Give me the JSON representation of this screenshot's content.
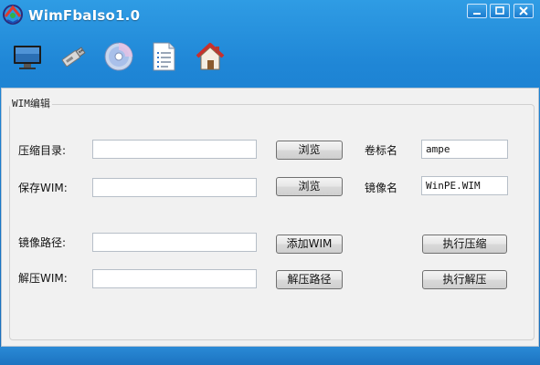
{
  "window": {
    "title": "WimFbaIso1.0",
    "controls": [
      "minimize-icon",
      "maximize-icon",
      "close-icon"
    ]
  },
  "toolbar": {
    "icons": [
      "monitor-icon",
      "usb-drive-icon",
      "cd-disc-icon",
      "document-list-icon",
      "home-icon"
    ]
  },
  "group": {
    "title": "WIM编辑"
  },
  "form": {
    "compress_dir_label": "压缩目录:",
    "compress_dir_value": "",
    "browse1_label": "浏览",
    "volume_label": "卷标名",
    "volume_value": "ampe",
    "save_wim_label": "保存WIM:",
    "save_wim_value": "",
    "browse2_label": "浏览",
    "image_name_label": "镜像名",
    "image_name_value": "WinPE.WIM",
    "image_path_label": "镜像路径:",
    "image_path_value": "",
    "add_wim_label": "添加WIM",
    "exec_compress_label": "执行压缩",
    "extract_wim_label": "解压WIM:",
    "extract_wim_value": "",
    "extract_path_label": "解压路径",
    "exec_extract_label": "执行解压"
  },
  "colors": {
    "titlebar": "#1f86d6",
    "panel": "#f1f1f1"
  }
}
